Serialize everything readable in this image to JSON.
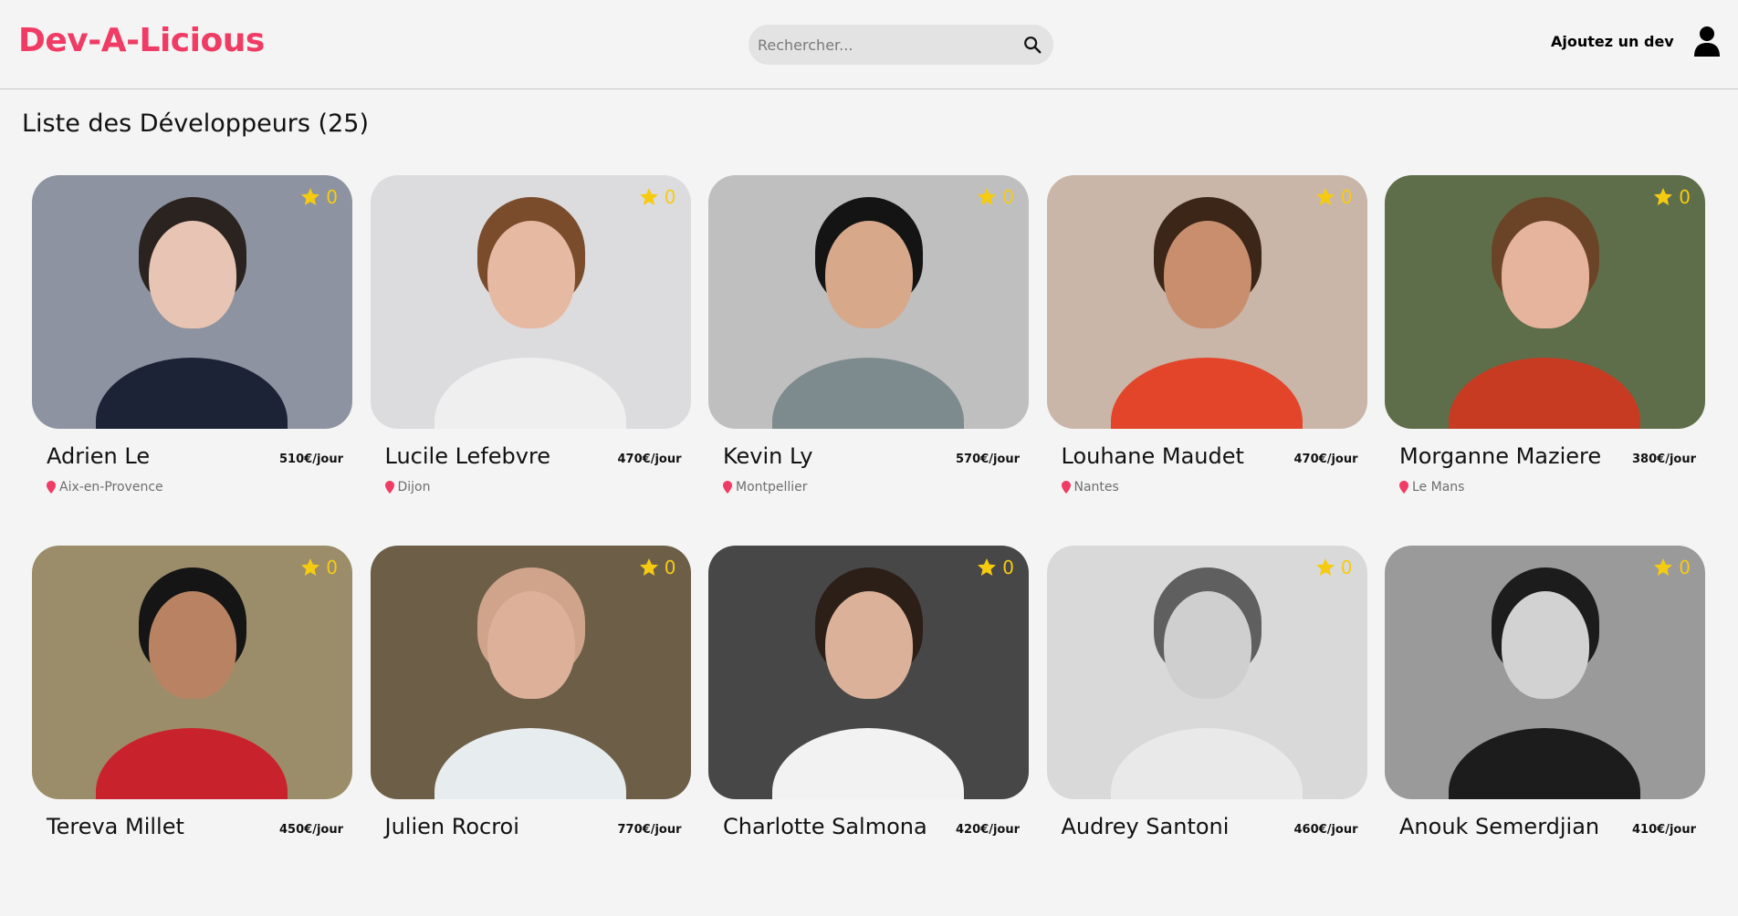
{
  "header": {
    "logo": "Dev-A-Licious",
    "search_placeholder": "Rechercher...",
    "add_dev_label": "Ajoutez un dev"
  },
  "page": {
    "title": "Liste des Développeurs (25)"
  },
  "colors": {
    "brand": "#f03c64",
    "star": "#f5cb12",
    "pin": "#f03c64"
  },
  "developers": [
    {
      "name": "Adrien Le",
      "price": "510€/jour",
      "city": "Aix-en-Provence",
      "rating": "0",
      "bg": "#8d93a0",
      "skin": "#e8c4b4",
      "hair": "#2a2320",
      "shirt": "#1d2336"
    },
    {
      "name": "Lucile Lefebvre",
      "price": "470€/jour",
      "city": "Dijon",
      "rating": "0",
      "bg": "#dcdcdf",
      "skin": "#e6b9a3",
      "hair": "#7a4c2c",
      "shirt": "#efefef"
    },
    {
      "name": "Kevin Ly",
      "price": "570€/jour",
      "city": "Montpellier",
      "rating": "0",
      "bg": "#bfbfbf",
      "skin": "#d8a88b",
      "hair": "#141414",
      "shirt": "#7e8b8e"
    },
    {
      "name": "Louhane Maudet",
      "price": "470€/jour",
      "city": "Nantes",
      "rating": "0",
      "bg": "#c9b6a8",
      "skin": "#c98e6e",
      "hair": "#3b2618",
      "shirt": "#e3452a"
    },
    {
      "name": "Morganne Maziere",
      "price": "380€/jour",
      "city": "Le Mans",
      "rating": "0",
      "bg": "#5f6e4a",
      "skin": "#e6b39d",
      "hair": "#6b4428",
      "shirt": "#c63b22"
    },
    {
      "name": "Tereva Millet",
      "price": "450€/jour",
      "city": "",
      "rating": "0",
      "bg": "#9c8d6a",
      "skin": "#b98363",
      "hair": "#151515",
      "shirt": "#c8232c"
    },
    {
      "name": "Julien Rocroi",
      "price": "770€/jour",
      "city": "",
      "rating": "0",
      "bg": "#6d5e48",
      "skin": "#ddb09a",
      "hair": "#cfa48b",
      "shirt": "#e7ecef"
    },
    {
      "name": "Charlotte Salmona",
      "price": "420€/jour",
      "city": "",
      "rating": "0",
      "bg": "#474747",
      "skin": "#dcb19a",
      "hair": "#2c1f17",
      "shirt": "#f2f2f2"
    },
    {
      "name": "Audrey Santoni",
      "price": "460€/jour",
      "city": "",
      "rating": "0",
      "bg": "#d9d9d9",
      "skin": "#cfcfcf",
      "hair": "#5f5f5f",
      "shirt": "#e9e9e9"
    },
    {
      "name": "Anouk Semerdjian",
      "price": "410€/jour",
      "city": "",
      "rating": "0",
      "bg": "#9a9a9a",
      "skin": "#d2d2d2",
      "hair": "#1c1c1c",
      "shirt": "#1c1c1c"
    }
  ]
}
